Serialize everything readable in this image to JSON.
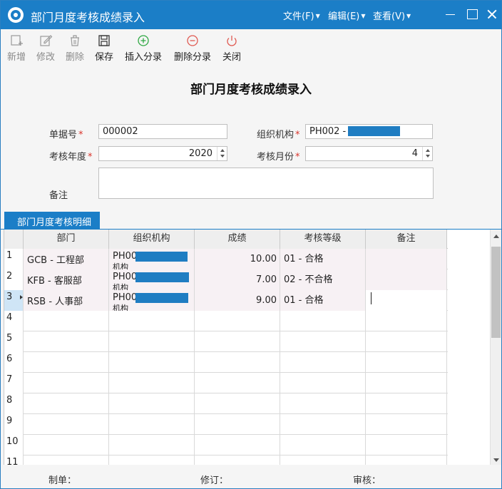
{
  "window": {
    "title": "部门月度考核成绩录入",
    "menus": [
      "文件(F)",
      "编辑(E)",
      "查看(V)"
    ]
  },
  "toolbar": [
    {
      "label": "新增",
      "icon": "new-icon",
      "enabled": false
    },
    {
      "label": "修改",
      "icon": "edit-icon",
      "enabled": false
    },
    {
      "label": "删除",
      "icon": "delete-icon",
      "enabled": false
    },
    {
      "label": "保存",
      "icon": "save-icon",
      "enabled": true
    },
    {
      "label": "插入分录",
      "icon": "add-circle-icon",
      "enabled": true,
      "color": "#2fa843"
    },
    {
      "label": "删除分录",
      "icon": "remove-circle-icon",
      "enabled": true,
      "color": "#e05a52"
    },
    {
      "label": "关闭",
      "icon": "power-icon",
      "enabled": true,
      "color": "#e05a52"
    }
  ],
  "form": {
    "title": "部门月度考核成绩录入",
    "doc_no": {
      "label": "单据号",
      "value": "000002"
    },
    "org": {
      "label": "组织机构",
      "value": "PH002 - "
    },
    "year": {
      "label": "考核年度",
      "value": "2020"
    },
    "month": {
      "label": "考核月份",
      "value": "4"
    },
    "remark": {
      "label": "备注",
      "value": ""
    }
  },
  "tab": {
    "label": "部门月度考核明细"
  },
  "grid": {
    "columns": [
      "部门",
      "组织机构",
      "成绩",
      "考核等级",
      "备注"
    ],
    "rows": [
      {
        "num": "1",
        "dept": "GCB - 工程部",
        "org": "PH00",
        "org_cut": "机构",
        "score": "10.00",
        "grade": "01 - 合格",
        "remark": ""
      },
      {
        "num": "2",
        "dept": "KFB - 客服部",
        "org": "PH00",
        "org_cut": "机构",
        "score": "7.00",
        "grade": "02 - 不合格",
        "remark": ""
      },
      {
        "num": "3",
        "dept": "RSB - 人事部",
        "org": "PH00",
        "org_cut": "机构",
        "score": "9.00",
        "grade": "01 - 合格",
        "remark": ""
      }
    ],
    "empty_row_nums": [
      "4",
      "5",
      "6",
      "7",
      "8",
      "9",
      "10",
      "11"
    ]
  },
  "footer": {
    "maker": "制单：",
    "reviser": "修订：",
    "auditor": "审核："
  },
  "colors": {
    "accent": "#1b7ec7",
    "required": "#d9342b",
    "mask": "#1f7dc2"
  }
}
